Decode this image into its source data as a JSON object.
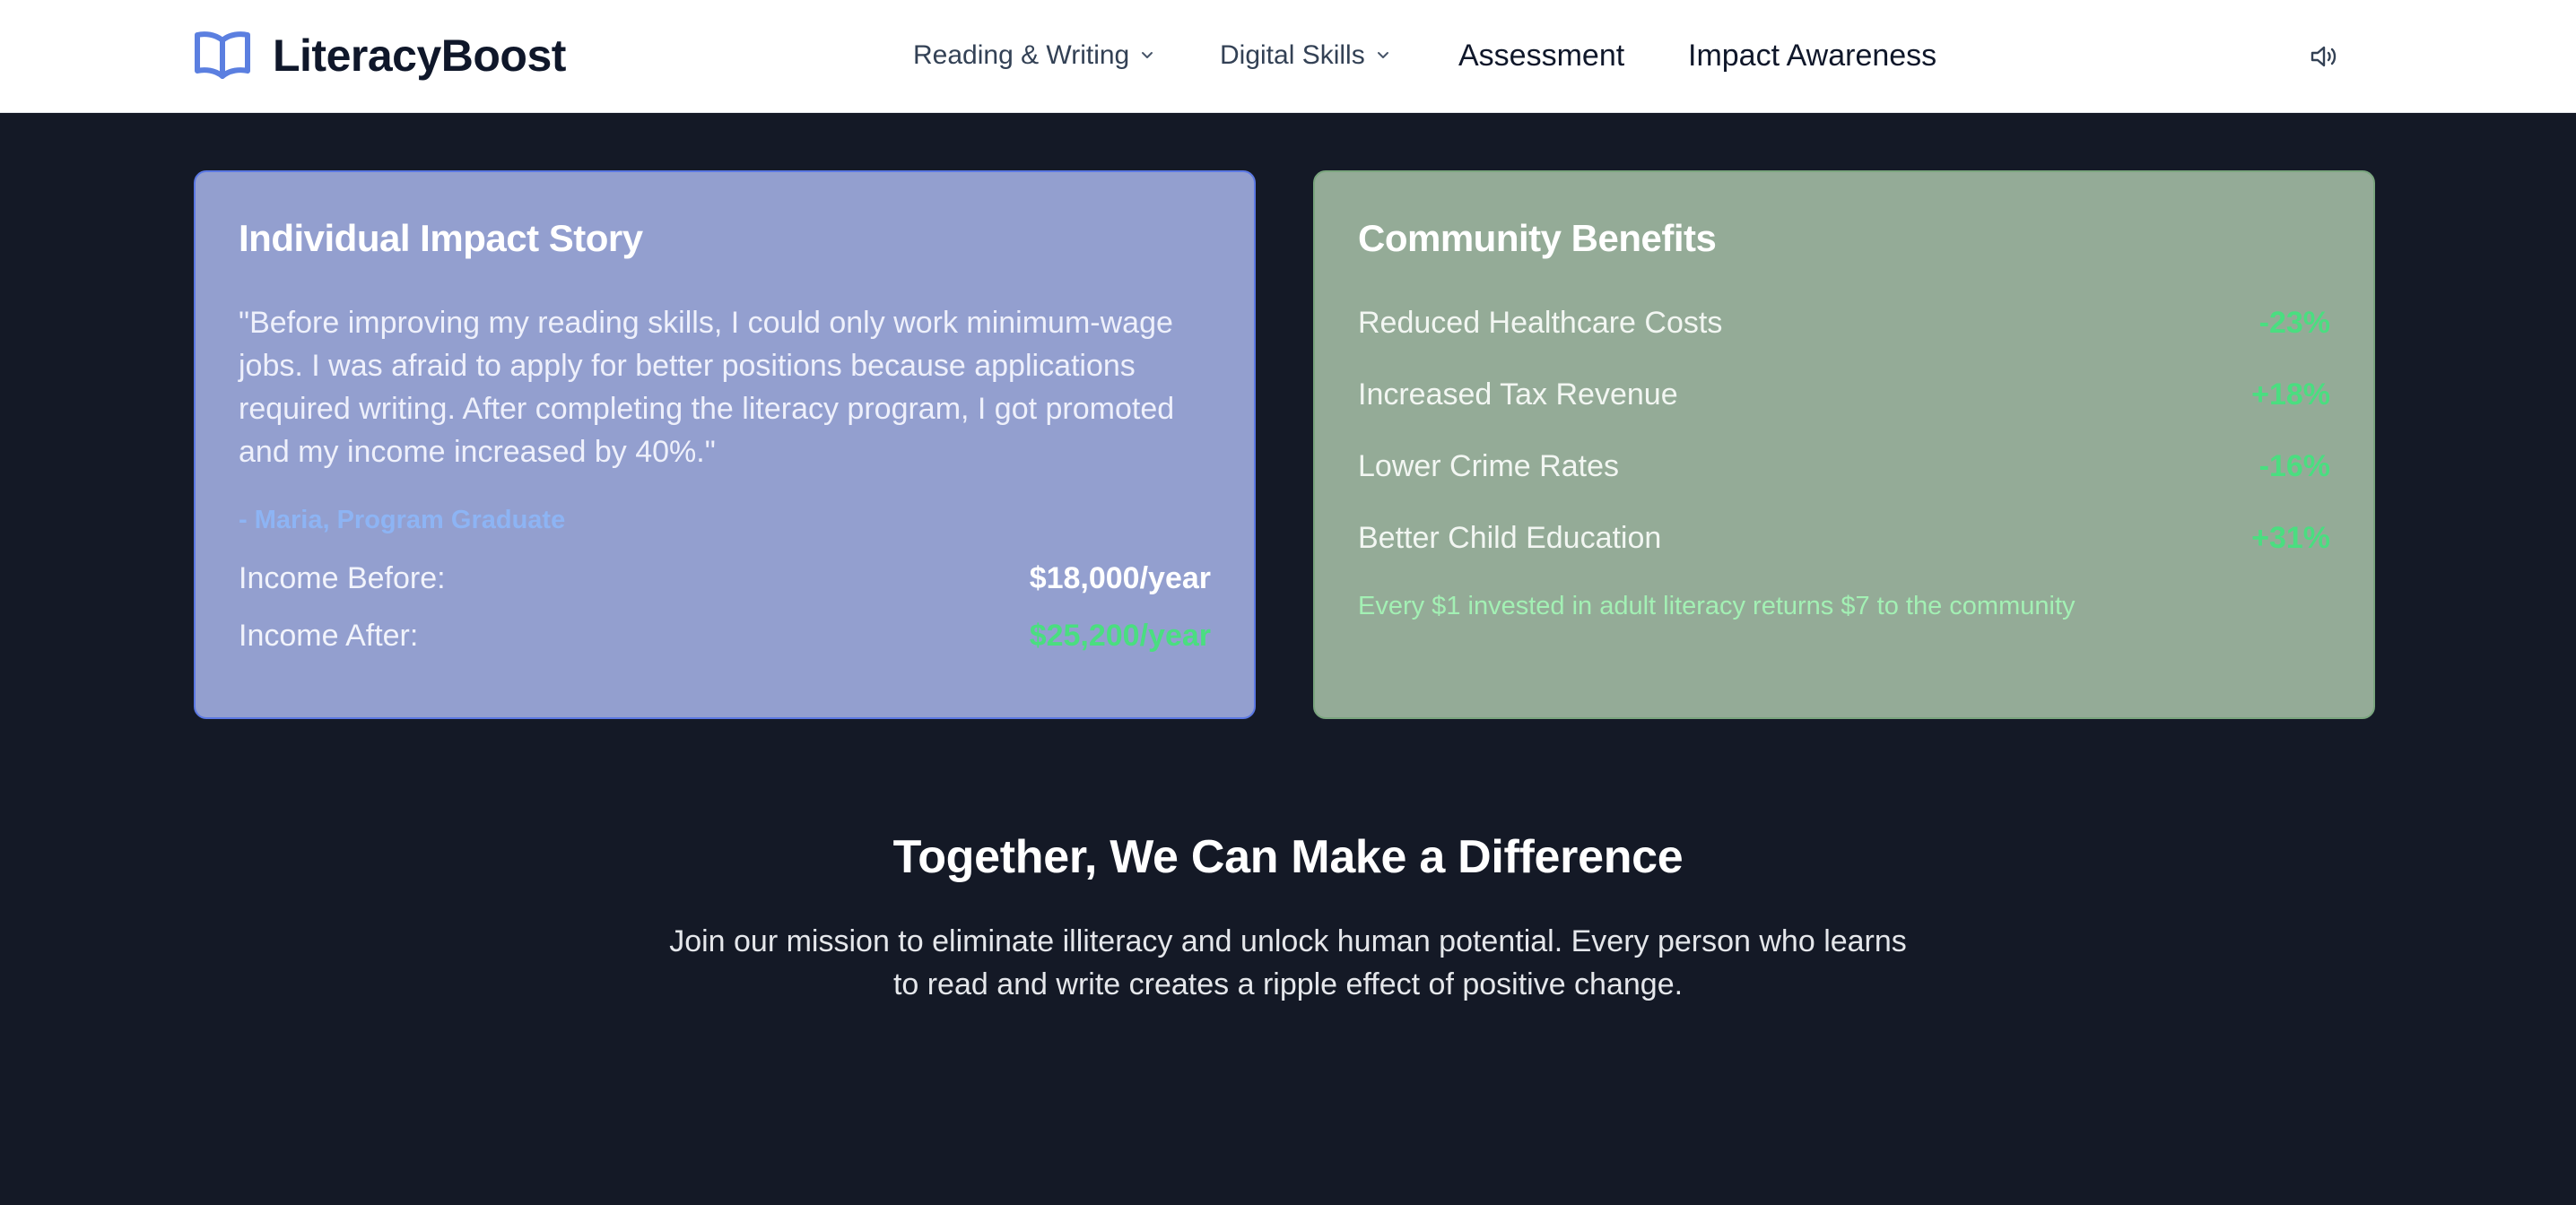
{
  "header": {
    "brand_name": "LiteracyBoost",
    "brand_icon": "open-book-icon",
    "nav": [
      {
        "label": "Reading & Writing",
        "has_dropdown": true
      },
      {
        "label": "Digital Skills",
        "has_dropdown": true
      },
      {
        "label": "Assessment",
        "has_dropdown": false
      },
      {
        "label": "Impact Awareness",
        "has_dropdown": false
      }
    ],
    "audio_icon": "speaker-icon"
  },
  "impact_story": {
    "title": "Individual Impact Story",
    "quote": "\"Before improving my reading skills, I could only work minimum-wage jobs. I was afraid to apply for better positions because applications required writing. After completing the literacy program, I got promoted and my income increased by 40%.\"",
    "attribution": "- Maria, Program Graduate",
    "income_before_label": "Income Before:",
    "income_before_value": "$18,000/year",
    "income_after_label": "Income After:",
    "income_after_value": "$25,200/year"
  },
  "community": {
    "title": "Community Benefits",
    "benefits": [
      {
        "label": "Reduced Healthcare Costs",
        "value": "-23%"
      },
      {
        "label": "Increased Tax Revenue",
        "value": "+18%"
      },
      {
        "label": "Lower Crime Rates",
        "value": "-16%"
      },
      {
        "label": "Better Child Education",
        "value": "+31%"
      }
    ],
    "note": "Every $1 invested in adult literacy returns $7 to the community"
  },
  "cta": {
    "title": "Together, We Can Make a Difference",
    "text": "Join our mission to eliminate illiteracy and unlock human potential. Every person who learns to read and write creates a ripple effect of positive change."
  },
  "colors": {
    "page_background": "#141926",
    "brand_accent": "#5b7fe0",
    "blue_card": "#939fcf",
    "green_card": "#94ab97",
    "positive_value": "#4ade80"
  }
}
